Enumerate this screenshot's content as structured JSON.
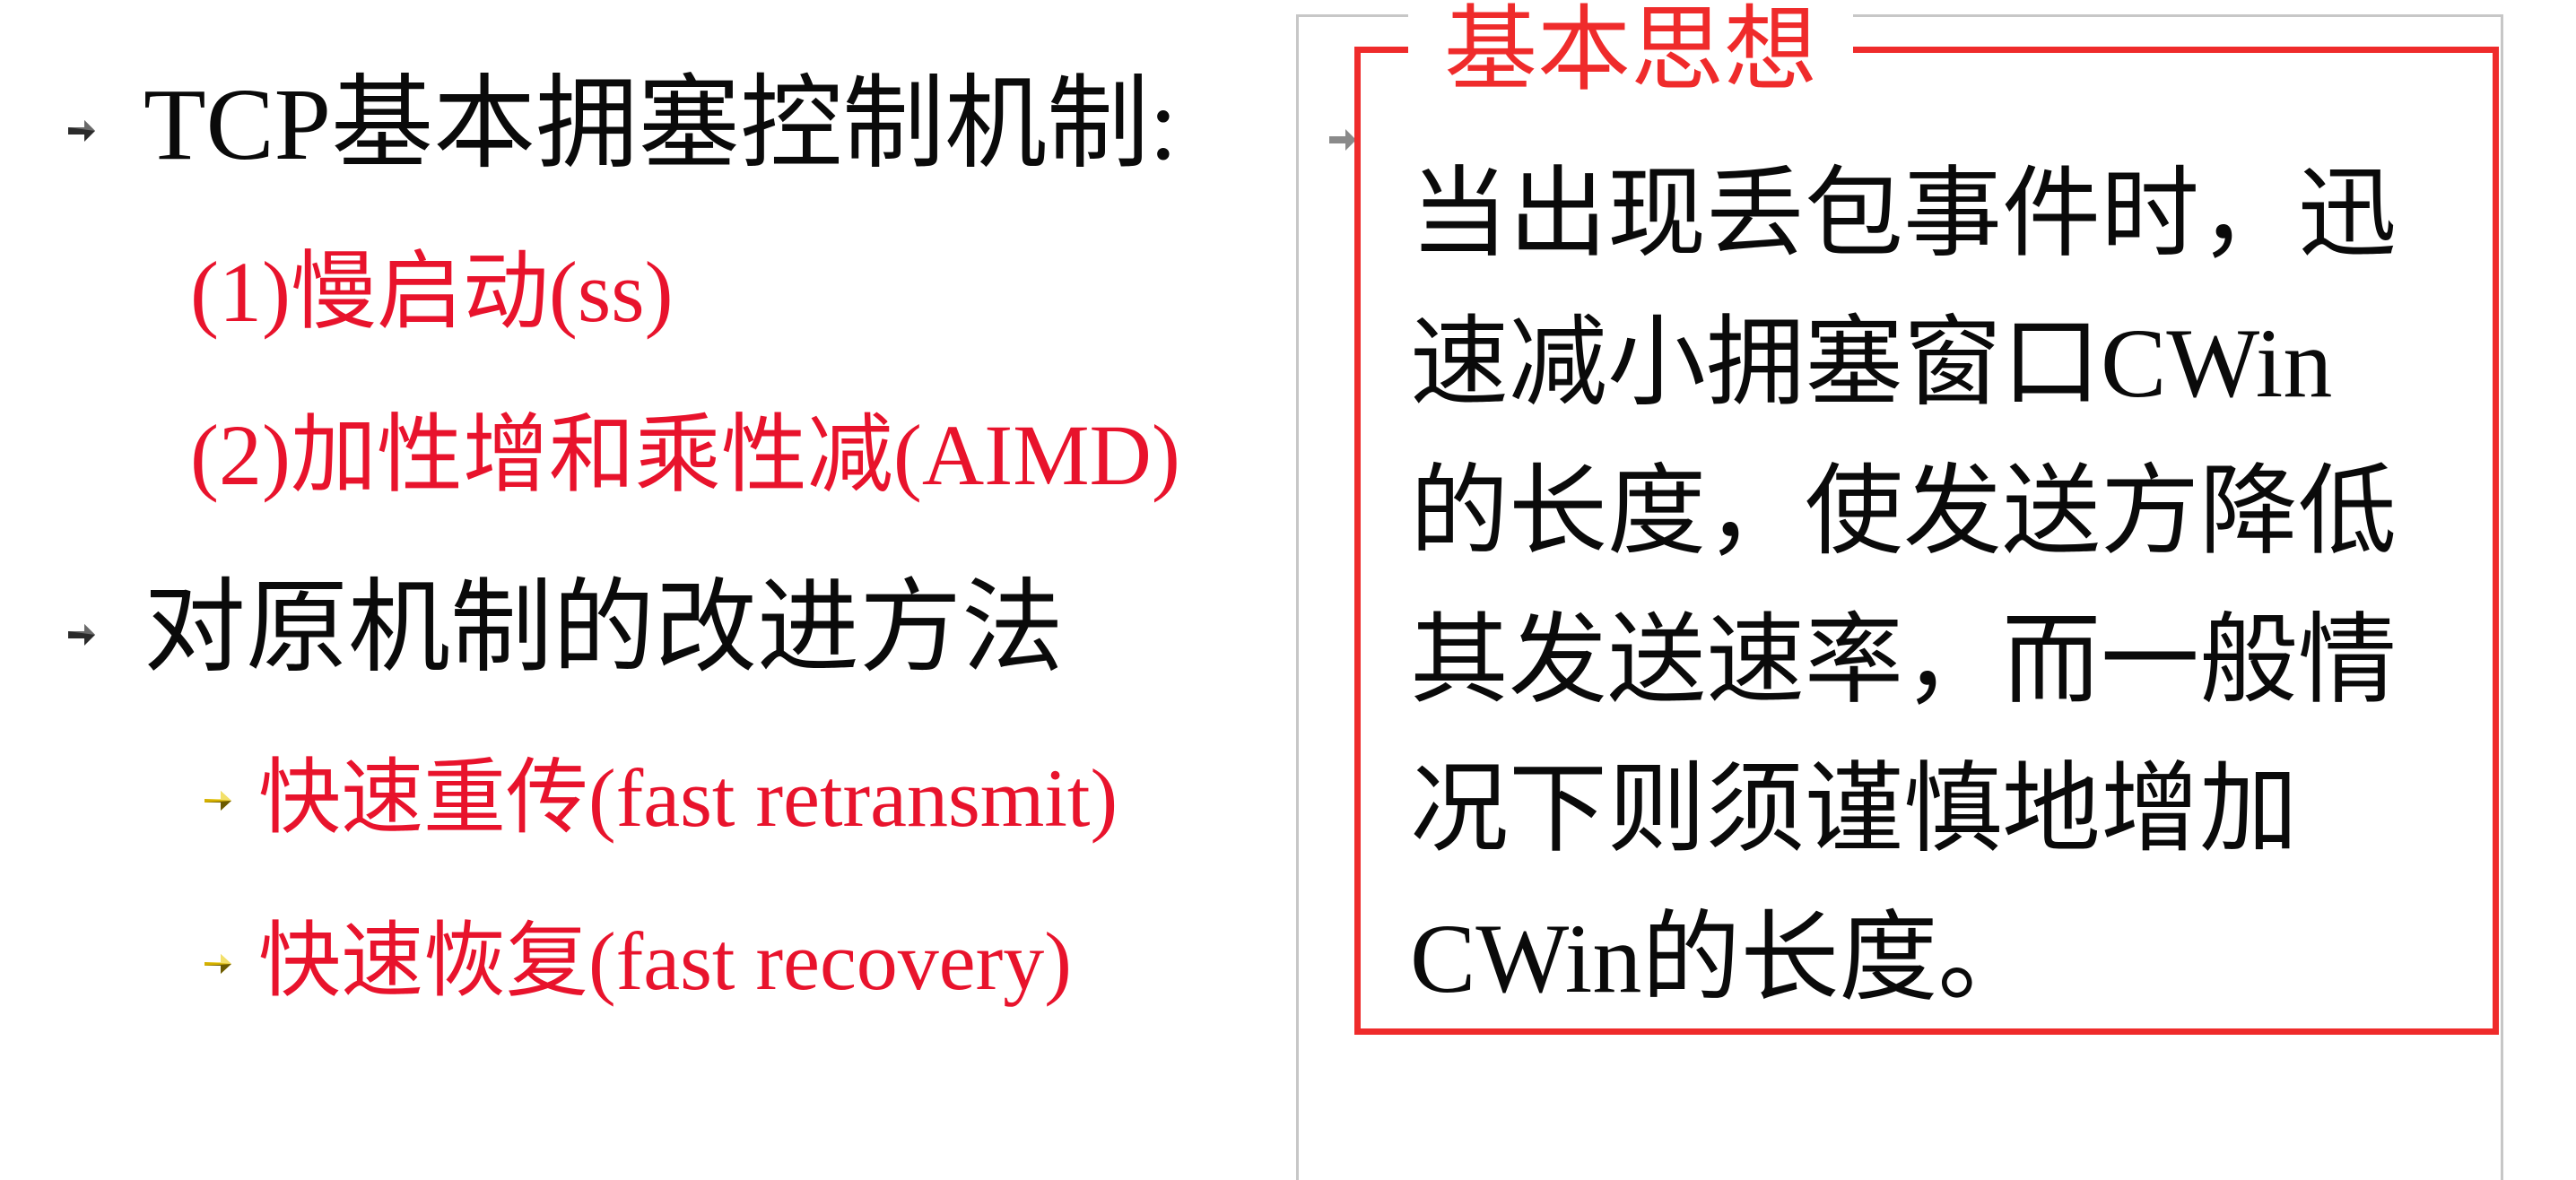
{
  "left": {
    "heading1": "TCP基本拥塞控制机制:",
    "sub1": "(1)慢启动(ss)",
    "sub2": "(2)加性增和乘性减(AIMD)",
    "heading2": "对原机制的改进方法",
    "item1": "快速重传(fast retransmit)",
    "item2": "快速恢复(fast recovery)"
  },
  "callout": {
    "title": "基本思想",
    "lines": [
      "当出现丢包事件时，迅",
      "速减小拥塞窗口CWin",
      "的长度，使发送方降低",
      "其发送速率，而一般情",
      "况下则须谨慎地增加",
      "CWin的长度。"
    ]
  },
  "colors": {
    "text": "#0a0a0a",
    "accent_red": "#e8132c",
    "callout_border": "#ef2b2b",
    "bullet_gold": "#d4b000"
  },
  "icons": {
    "main_bullet": "arrow-right-bullet-icon",
    "sub_bullet": "gold-arrow-bullet-icon"
  }
}
